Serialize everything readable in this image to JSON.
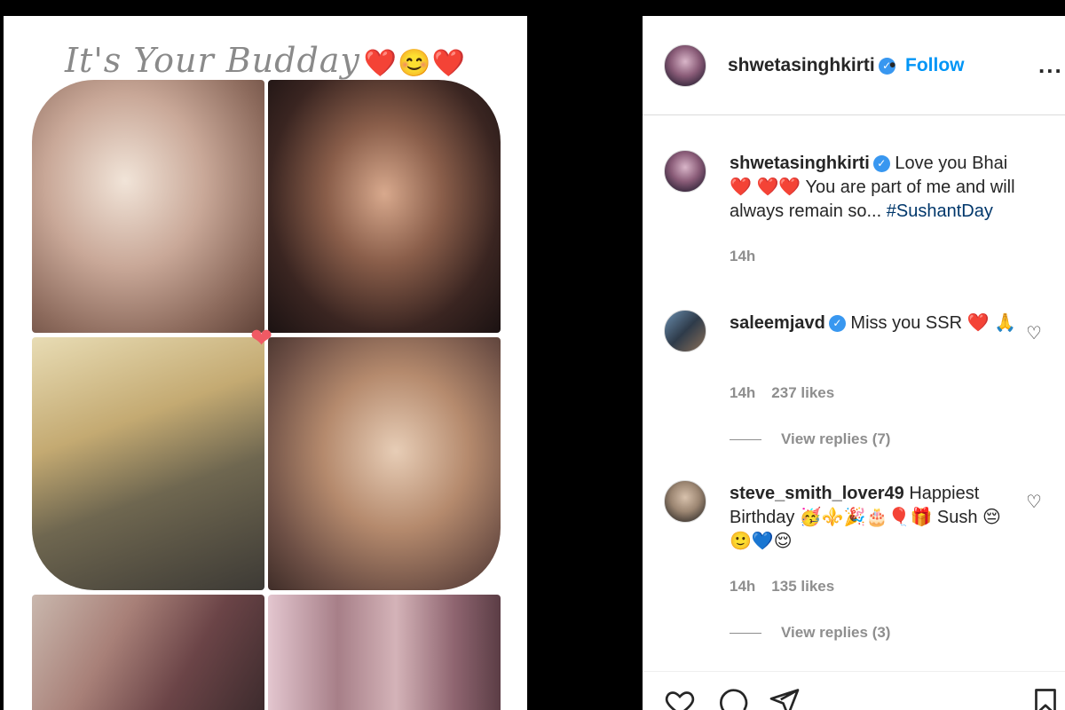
{
  "collage": {
    "title": "It's Your Budday",
    "title_emojis": "❤️😊❤️",
    "heart": "❤"
  },
  "header": {
    "username": "shwetasinghkirti",
    "separator": "•",
    "follow_label": "Follow",
    "more_label": "..."
  },
  "caption": {
    "username": "shwetasinghkirti",
    "text_1": "Love you Bhai ",
    "hearts_1": "❤️",
    "hearts_2": "❤️❤️",
    "text_2": " You are part of me and will always remain so... ",
    "hashtag": "#SushantDay",
    "time": "14h"
  },
  "comments": [
    {
      "username": "saleemjavd",
      "text": "Miss you SSR ❤️ 🙏",
      "time": "14h",
      "likes": "237 likes",
      "view_replies": "View replies (7)"
    },
    {
      "username": "steve_smith_lover49",
      "text": "Happiest Birthday 🥳⚜️🎉🎂🎈🎁 Sush 😔🙂💙😌",
      "time": "14h",
      "likes": "135 likes",
      "view_replies": "View replies (3)"
    }
  ],
  "icons": {
    "verified": "✓",
    "comment_heart": "♡"
  }
}
